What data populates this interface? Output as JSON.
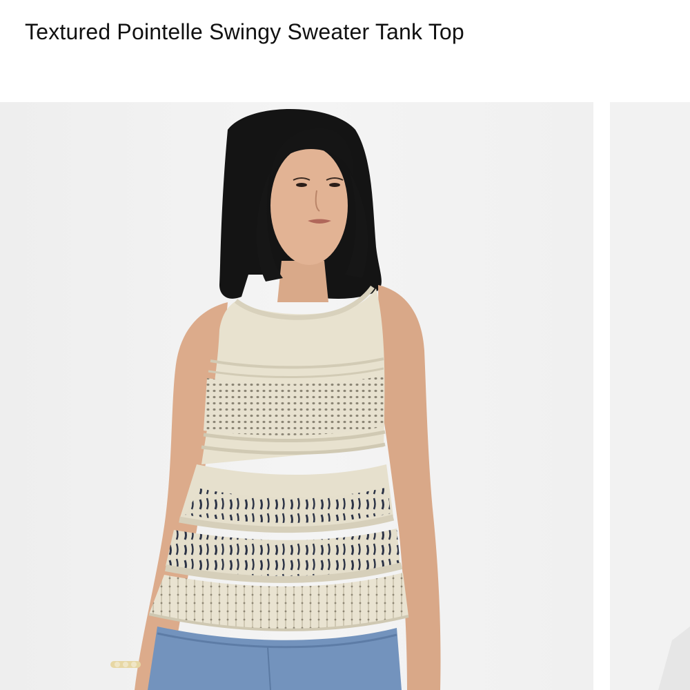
{
  "product": {
    "title": "Textured Pointelle Swingy Sweater Tank Top"
  },
  "gallery": {
    "images": [
      {
        "name": "main",
        "depicts": "model-in-cream-crochet-tank-and-denim"
      },
      {
        "name": "next",
        "depicts": "next-product-photo-partially-visible"
      }
    ]
  },
  "colors": {
    "background": "#ffffff",
    "photo_background": "#f2f2f2",
    "title_text": "#111111",
    "garment_cream": "#e9e4d3",
    "hair": "#151515",
    "denim": "#6f8fb8"
  }
}
